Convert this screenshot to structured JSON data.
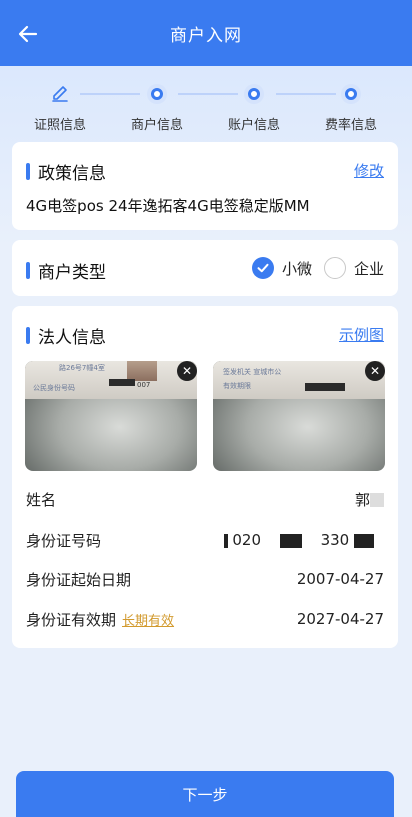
{
  "header": {
    "title": "商户入网"
  },
  "steps": [
    {
      "label": "证照信息"
    },
    {
      "label": "商户信息"
    },
    {
      "label": "账户信息"
    },
    {
      "label": "费率信息"
    }
  ],
  "policy": {
    "title": "政策信息",
    "edit_label": "修改",
    "value": "4G电签pos 24年逸拓客4G电签稳定版MM"
  },
  "merchant_type": {
    "title": "商户类型",
    "options": [
      {
        "label": "小微",
        "selected": true
      },
      {
        "label": "企业",
        "selected": false
      }
    ]
  },
  "legal_person": {
    "title": "法人信息",
    "example_label": "示例图",
    "front_photo_text": "公民身份号码",
    "front_photo_addr": "路26号7幢4室",
    "front_photo_num": "007",
    "back_photo_text": "签发机关",
    "back_photo_issuer": "签发机关  宣城市公",
    "back_photo_valid": "有效期限",
    "fields": {
      "name_label": "姓名",
      "name_value": "郭",
      "id_label": "身份证号码",
      "id_value_a": "020",
      "id_value_b": "330",
      "start_label": "身份证起始日期",
      "start_value": "2007-04-27",
      "expiry_label": "身份证有效期",
      "expiry_tag": "长期有效",
      "expiry_value": "2027-04-27"
    }
  },
  "footer": {
    "next_label": "下一步"
  },
  "colors": {
    "primary": "#3a7bf0",
    "tag": "#d29a2e"
  }
}
